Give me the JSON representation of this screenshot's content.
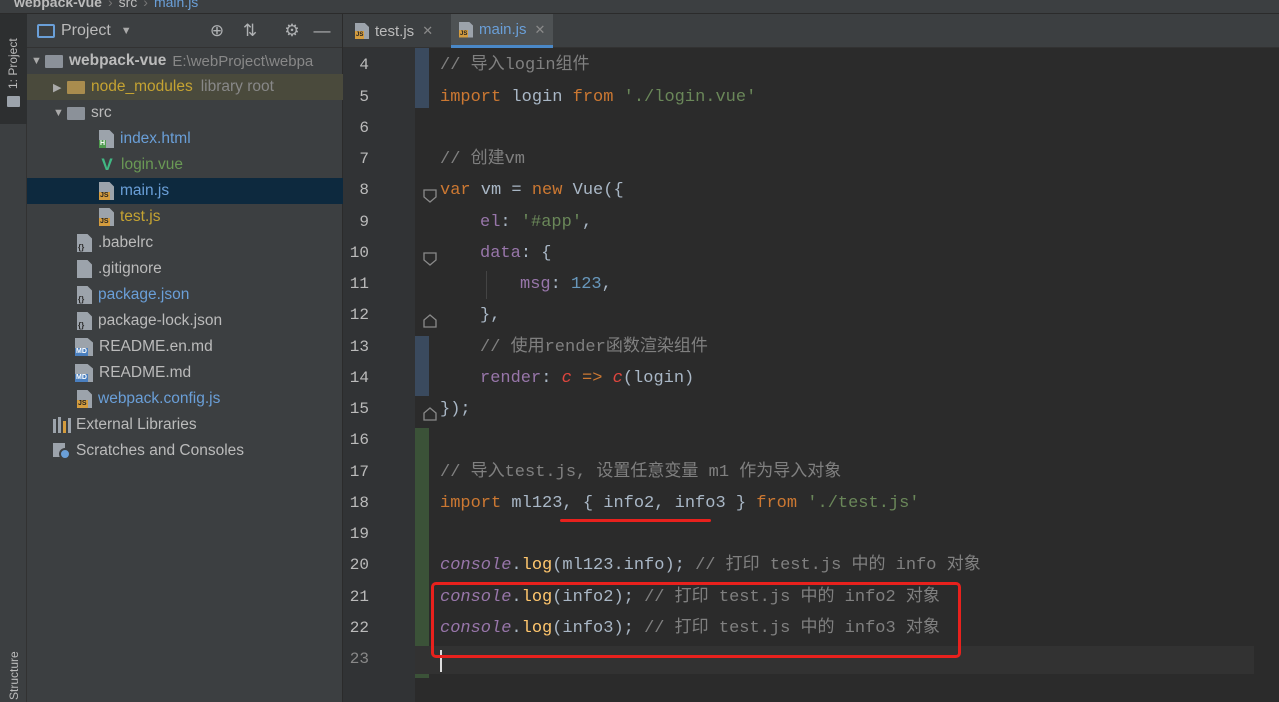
{
  "breadcrumb": {
    "project": "webpack-vue",
    "folder": "src",
    "file": "main.js"
  },
  "toolstrip": {
    "project_tab": "1: Project",
    "structure_tab": "Structure"
  },
  "project_panel": {
    "title": "Project",
    "tree": [
      {
        "label": "webpack-vue",
        "suffix": "E:\\webProject\\webpa",
        "kind": "root"
      },
      {
        "label": "node_modules",
        "suffix": "library root",
        "kind": "folder-lib"
      },
      {
        "label": "src",
        "kind": "folder"
      },
      {
        "label": "index.html",
        "kind": "html"
      },
      {
        "label": "login.vue",
        "kind": "vue"
      },
      {
        "label": "main.js",
        "kind": "js",
        "selected": true
      },
      {
        "label": "test.js",
        "kind": "js"
      },
      {
        "label": ".babelrc",
        "kind": "config"
      },
      {
        "label": ".gitignore",
        "kind": "text"
      },
      {
        "label": "package.json",
        "kind": "config"
      },
      {
        "label": "package-lock.json",
        "kind": "config"
      },
      {
        "label": "README.en.md",
        "kind": "md"
      },
      {
        "label": "README.md",
        "kind": "md"
      },
      {
        "label": "webpack.config.js",
        "kind": "js"
      },
      {
        "label": "External Libraries",
        "kind": "lib"
      },
      {
        "label": "Scratches and Consoles",
        "kind": "scratch"
      }
    ]
  },
  "tabs": [
    {
      "label": "test.js",
      "active": false
    },
    {
      "label": "main.js",
      "active": true
    }
  ],
  "code": {
    "line_numbers": [
      "4",
      "5",
      "6",
      "7",
      "8",
      "9",
      "10",
      "11",
      "12",
      "13",
      "14",
      "15",
      "16",
      "17",
      "18",
      "19",
      "20",
      "21",
      "22",
      "23"
    ],
    "l4": "// 导入login组件",
    "l5_kw": "import",
    "l5_id": " login ",
    "l5_from": "from",
    "l5_str": " './login.vue'",
    "l7": "// 创建vm",
    "l8_kw": "var",
    "l8_id": " vm = ",
    "l8_new": "new",
    "l8_rest": " Vue({",
    "l9_prop": "el",
    "l9_colon": ": ",
    "l9_str": "'#app'",
    "l9_end": ",",
    "l10_prop": "data",
    "l10_rest": ": {",
    "l11_prop": "msg",
    "l11_colon": ": ",
    "l11_num": "123",
    "l11_end": ",",
    "l12": "},",
    "l13": "// 使用render函数渲染组件",
    "l14_prop": "render",
    "l14_colon": ": ",
    "l14_c1": "c",
    "l14_arrow": " => ",
    "l14_c2": "c",
    "l14_rest": "(login)",
    "l15": "});",
    "l17": "// 导入test.js, 设置任意变量 m1 作为导入对象",
    "l18_kw": "import",
    "l18_id": " ml123, ",
    "l18_braces": "{ info2, info3 }",
    "l18_from": " from",
    "l18_str": " './test.js'",
    "l20_obj": "console",
    "l20_dot": ".",
    "l20_fn": "log",
    "l20_args": "(ml123.info); ",
    "l20_cmt": "// 打印 test.js 中的 info 对象",
    "l21_obj": "console",
    "l21_dot": ".",
    "l21_fn": "log",
    "l21_args": "(info2); ",
    "l21_cmt": "// 打印 test.js 中的 info2 对象",
    "l22_obj": "console",
    "l22_dot": ".",
    "l22_fn": "log",
    "l22_args": "(info3); ",
    "l22_cmt": "// 打印 test.js 中的 info3 对象"
  },
  "colors": {
    "annotation": "#e8211d",
    "selection": "#0d293e",
    "accent": "#4a88c7"
  }
}
